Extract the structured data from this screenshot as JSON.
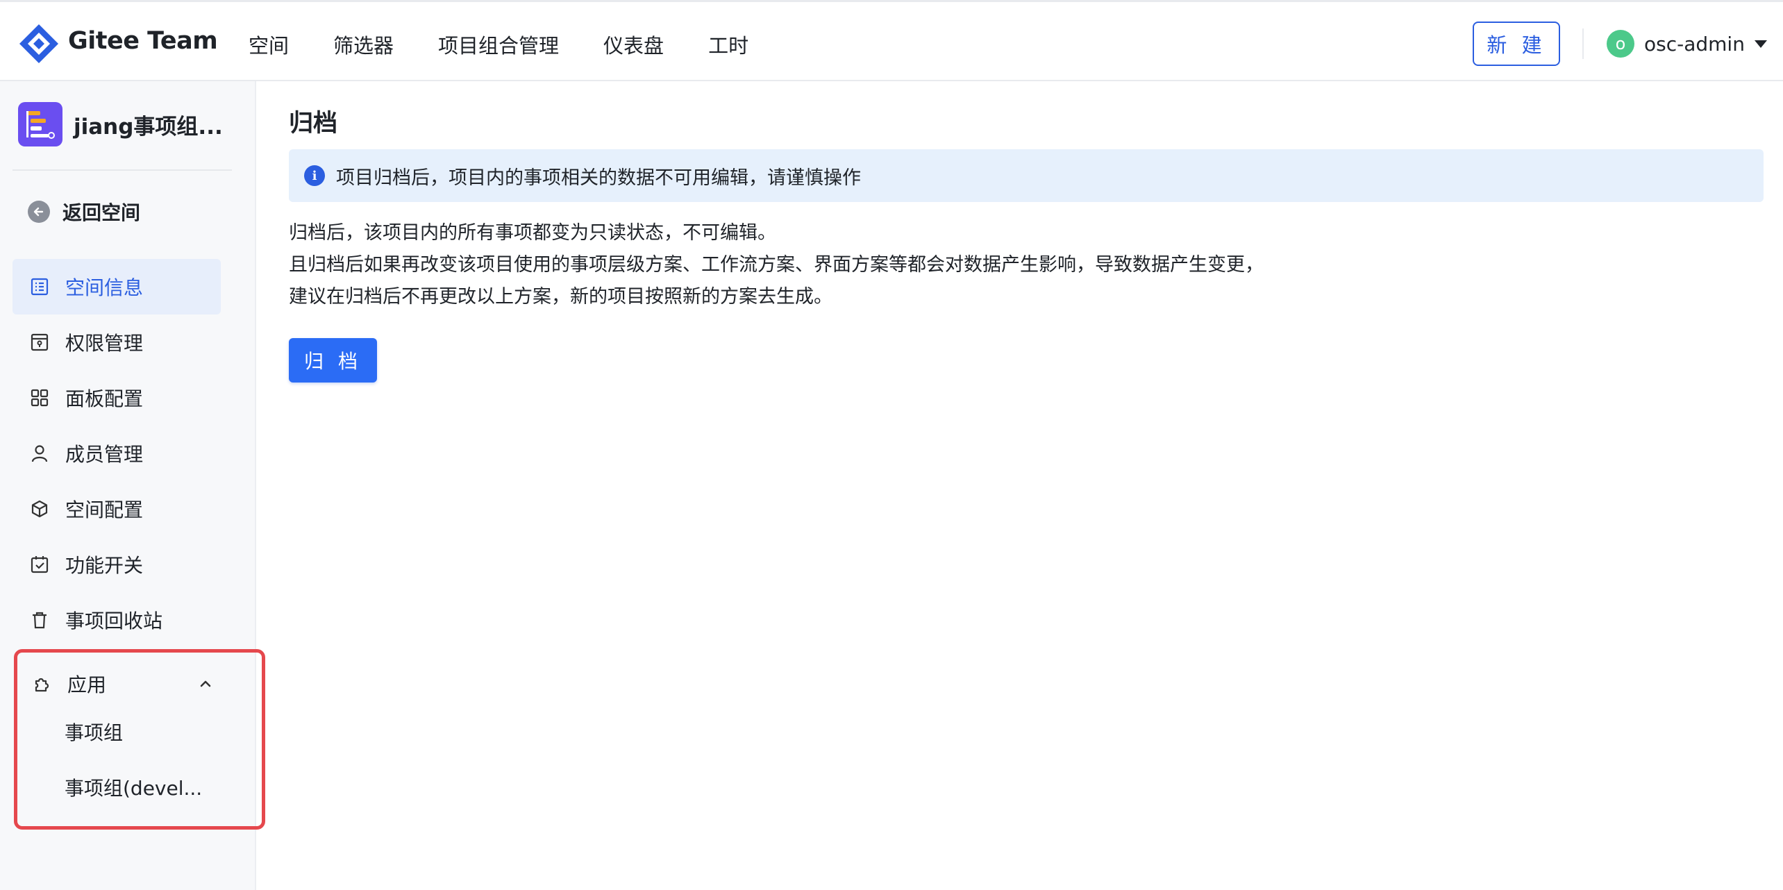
{
  "header": {
    "brand": "Gitee Team",
    "nav": [
      "空间",
      "筛选器",
      "项目组合管理",
      "仪表盘",
      "工时"
    ],
    "new_button": "新 建",
    "user": {
      "avatar_letter": "o",
      "name": "osc-admin"
    }
  },
  "sidebar": {
    "project_name": "jiang事项组...",
    "back_label": "返回空间",
    "items": [
      {
        "label": "空间信息",
        "icon": "list-icon",
        "active": true
      },
      {
        "label": "权限管理",
        "icon": "key-card-icon"
      },
      {
        "label": "面板配置",
        "icon": "grid-icon"
      },
      {
        "label": "成员管理",
        "icon": "user-icon"
      },
      {
        "label": "空间配置",
        "icon": "cube-icon"
      },
      {
        "label": "功能开关",
        "icon": "calendar-check-icon"
      },
      {
        "label": "事项回收站",
        "icon": "trash-icon"
      }
    ],
    "apps": {
      "label": "应用",
      "icon": "puzzle-icon",
      "expanded": true,
      "children": [
        "事项组",
        "事项组(devel..."
      ]
    }
  },
  "main": {
    "title": "归档",
    "alert": "项目归档后，项目内的事项相关的数据不可用编辑，请谨慎操作",
    "description": [
      "归档后，该项目内的所有事项都变为只读状态，不可编辑。",
      "且归档后如果再改变该项目使用的事项层级方案、工作流方案、界面方案等都会对数据产生影响，导致数据产生变更，",
      "建议在归档后不再更改以上方案，新的项目按照新的方案去生成。"
    ],
    "archive_button": "归 档"
  },
  "colors": {
    "accent": "#2b5ee0",
    "active_bg": "#e7eefb",
    "alert_bg": "#e6f0fc",
    "highlight_border": "#e5484d",
    "avatar": "#4cc98a",
    "project_icon": "#6a4ef0"
  }
}
